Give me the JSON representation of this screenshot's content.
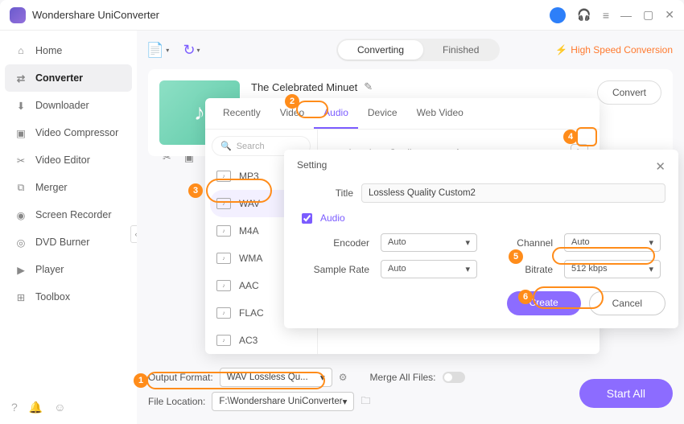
{
  "app": {
    "title": "Wondershare UniConverter"
  },
  "sidebar": {
    "items": [
      {
        "label": "Home"
      },
      {
        "label": "Converter"
      },
      {
        "label": "Downloader"
      },
      {
        "label": "Video Compressor"
      },
      {
        "label": "Video Editor"
      },
      {
        "label": "Merger"
      },
      {
        "label": "Screen Recorder"
      },
      {
        "label": "DVD Burner"
      },
      {
        "label": "Player"
      },
      {
        "label": "Toolbox"
      }
    ]
  },
  "tabs": {
    "converting": "Converting",
    "finished": "Finished"
  },
  "hsc": "High Speed Conversion",
  "file": {
    "title": "The Celebrated Minuet",
    "convert": "Convert"
  },
  "fmt": {
    "tabs": [
      "Recently",
      "Video",
      "Audio",
      "Device",
      "Web Video"
    ],
    "search": "Search",
    "items": [
      "MP3",
      "WAV",
      "M4A",
      "WMA",
      "AAC",
      "FLAC",
      "AC3"
    ],
    "quality_label": "Lossless Quality",
    "auto": "Auto"
  },
  "setting": {
    "title": "Setting",
    "title_label": "Title",
    "title_value": "Lossless Quality Custom2",
    "audio_label": "Audio",
    "encoder_label": "Encoder",
    "encoder_value": "Auto",
    "channel_label": "Channel",
    "channel_value": "Auto",
    "samplerate_label": "Sample Rate",
    "samplerate_value": "Auto",
    "bitrate_label": "Bitrate",
    "bitrate_value": "512 kbps",
    "create": "Create",
    "cancel": "Cancel"
  },
  "footer": {
    "output_format_label": "Output Format:",
    "output_format_value": "WAV Lossless Qu...",
    "merge_label": "Merge All Files:",
    "file_location_label": "File Location:",
    "file_location_value": "F:\\Wondershare UniConverter",
    "start_all": "Start All"
  },
  "callouts": [
    "1",
    "2",
    "3",
    "4",
    "5",
    "6"
  ]
}
